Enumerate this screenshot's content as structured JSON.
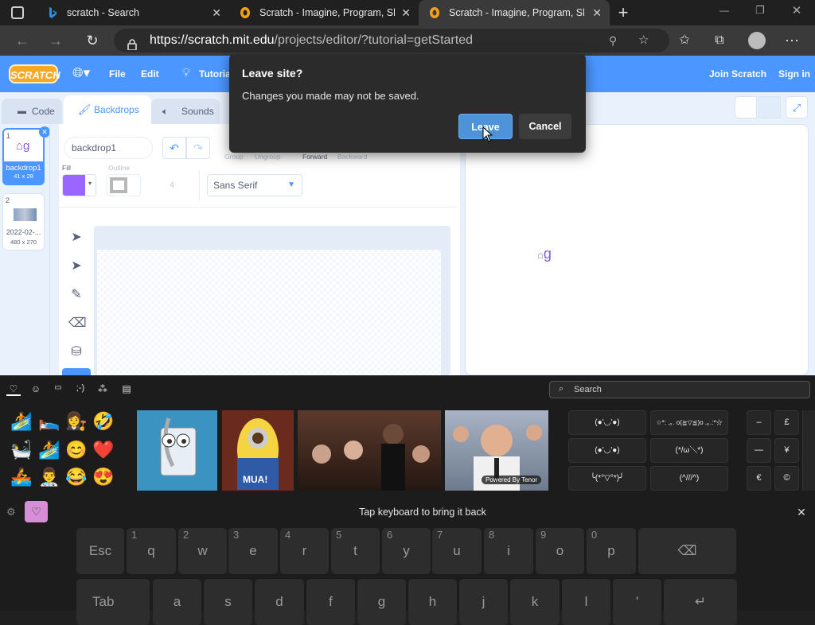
{
  "tabs": [
    {
      "title": "scratch - Search",
      "close": "✕",
      "active": false
    },
    {
      "title": "Scratch - Imagine, Program, Sha",
      "close": "✕",
      "active": false
    },
    {
      "title": "Scratch - Imagine, Program, Sha",
      "close": "✕",
      "active": true
    }
  ],
  "new_tab_label": "+",
  "window_controls": {
    "minimize": "—",
    "restore": "❐",
    "close": "✕"
  },
  "address": {
    "host_part": "https://scratch.mit.edu",
    "path_part": "/projects/editor/?tutorial=getStarted"
  },
  "scratch": {
    "logo": "SCRATCH",
    "menu": {
      "file": "File",
      "edit": "Edit",
      "tutorials": "Tutorials",
      "join": "Join Scratch",
      "signin": "Sign in"
    },
    "tabs": {
      "code": "Code",
      "backdrops": "Backdrops",
      "sounds": "Sounds"
    },
    "backdrops": [
      {
        "num": "1",
        "name": "backdrop1",
        "size": "41 x 28"
      },
      {
        "num": "2",
        "name": "2022-02-...",
        "size": "480 x 270"
      }
    ],
    "costume_name": "backdrop1",
    "fill_label": "Fill",
    "outline_label": "Outline",
    "outline_width": "4",
    "font": "Sans Serif",
    "arrange": {
      "group": "Group",
      "ungroup": "Ungroup",
      "forward": "Forward",
      "backward": "Backward"
    },
    "stage_preview_glyph": "g"
  },
  "dialog": {
    "title": "Leave site?",
    "message": "Changes you made may not be saved.",
    "leave": "Leave",
    "cancel": "Cancel"
  },
  "panel": {
    "search_placeholder": "Search",
    "tabs": [
      "favorites",
      "emoji",
      "gif",
      "kaomoji",
      "symbols",
      "clipboard"
    ],
    "emojis": [
      "🏄",
      "🛌",
      "👩‍⚖️",
      "🤣",
      "🛀",
      "🏄",
      "😊",
      "❤️",
      "🚣",
      "👨‍⚕️",
      "😂",
      "😍"
    ],
    "gif_labels": {
      "mua": "MUA!",
      "tenor": "Powered By Tenor"
    },
    "kaomoji": [
      "(●'◡'●)",
      "☆*: .｡. o(≧▽≦)o .｡.:*☆",
      "(●'◡'●)",
      "(*/ω＼*)",
      "╰(*°▽°*)╯",
      "(^///^)"
    ],
    "symbols": [
      "–",
      "£",
      "—",
      "¥",
      "€",
      "©"
    ],
    "tap_message": "Tap keyboard to bring it back",
    "close": "✕"
  },
  "keyboard": {
    "row1": [
      {
        "label": "Esc",
        "num": ""
      },
      {
        "label": "q",
        "num": "1"
      },
      {
        "label": "w",
        "num": "2"
      },
      {
        "label": "e",
        "num": "3"
      },
      {
        "label": "r",
        "num": "4"
      },
      {
        "label": "t",
        "num": "5"
      },
      {
        "label": "y",
        "num": "6"
      },
      {
        "label": "u",
        "num": "7"
      },
      {
        "label": "i",
        "num": "8"
      },
      {
        "label": "o",
        "num": "9"
      },
      {
        "label": "p",
        "num": "0"
      },
      {
        "label": "⌫",
        "num": ""
      }
    ],
    "row2": [
      "Tab",
      "a",
      "s",
      "d",
      "f",
      "g",
      "h",
      "j",
      "k",
      "l",
      "'",
      "↵"
    ]
  }
}
